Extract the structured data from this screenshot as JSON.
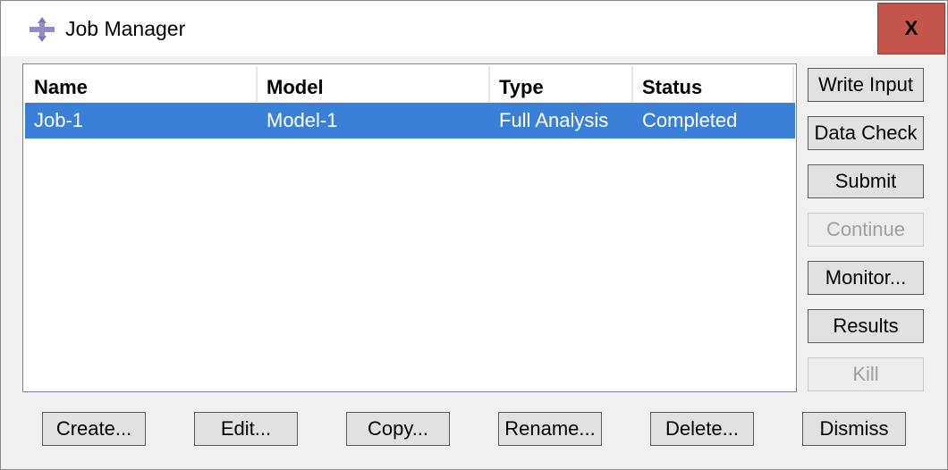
{
  "window": {
    "title": "Job Manager",
    "close_label": "X"
  },
  "table": {
    "columns": [
      "Name",
      "Model",
      "Type",
      "Status"
    ],
    "rows": [
      {
        "name": "Job-1",
        "model": "Model-1",
        "type": "Full Analysis",
        "status": "Completed",
        "selected": true
      }
    ]
  },
  "side_buttons": {
    "write_input": "Write Input",
    "data_check": "Data Check",
    "submit": "Submit",
    "continue": "Continue",
    "monitor": "Monitor...",
    "results": "Results",
    "kill": "Kill"
  },
  "bottom_buttons": {
    "create": "Create...",
    "edit": "Edit...",
    "copy": "Copy...",
    "rename": "Rename...",
    "delete": "Delete...",
    "dismiss": "Dismiss"
  },
  "colors": {
    "selection": "#3a80d6",
    "close_button": "#c4554a"
  },
  "icons": {
    "app": "abaqus-app-icon",
    "close": "close-icon"
  }
}
